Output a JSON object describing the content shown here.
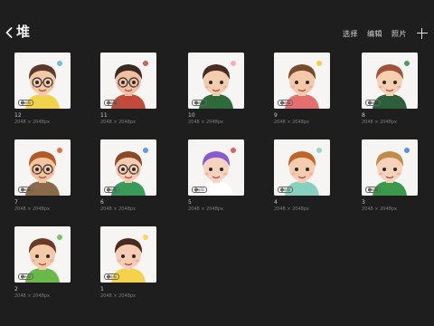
{
  "header": {
    "back_icon": "chevron-left-icon",
    "title": "堆",
    "select_label": "选择",
    "edit_label": "编辑",
    "photos_label": "照片",
    "add_icon": "plus-icon"
  },
  "artworks": [
    {
      "name": "12",
      "size": "2048 × 2048px",
      "watermark": "🅢ellii",
      "hair": "#5a3a2a",
      "skin": "#f3c9a8",
      "shirt": "#f0d34a",
      "glasses": true,
      "accent": "#5fb0d6"
    },
    {
      "name": "11",
      "size": "2048 × 2048px",
      "watermark": "🅢ellii",
      "hair": "#3a2a24",
      "skin": "#f0c0a0",
      "shirt": "#c24a3a",
      "glasses": true,
      "accent": "#c24a3a"
    },
    {
      "name": "10",
      "size": "2048 × 2048px",
      "watermark": "🅢ellii",
      "hair": "#4a2a22",
      "skin": "#f4cdb0",
      "shirt": "#2f6a3a",
      "glasses": false,
      "accent": "#f2a0b4"
    },
    {
      "name": "9",
      "size": "2048 × 2048px",
      "watermark": "🅢ellii",
      "hair": "#7a4a2e",
      "skin": "#f4c9aa",
      "shirt": "#e36f6f",
      "glasses": false,
      "accent": "#f4c430"
    },
    {
      "name": "8",
      "size": "2048 × 2048px",
      "watermark": "🅢ellii",
      "hair": "#a0523a",
      "skin": "#f6cfb0",
      "shirt": "#2f5f3a",
      "glasses": false,
      "accent": "#2f8a4a"
    },
    {
      "name": "7",
      "size": "2048 × 2048px",
      "watermark": "🅢ellii",
      "hair": "#b25a2a",
      "skin": "#f4c59f",
      "shirt": "#8a6a4a",
      "glasses": true,
      "accent": "#e0552f"
    },
    {
      "name": "6",
      "size": "2048 × 2048px",
      "watermark": "🅢ellii",
      "hair": "#8a4a2a",
      "skin": "#f6ccb0",
      "shirt": "#3a9a5a",
      "glasses": true,
      "accent": "#4a8ad6"
    },
    {
      "name": "5",
      "size": "2048 × 2048px",
      "watermark": "🅢ellii",
      "hair": "#8a5ad0",
      "skin": "#f6d3be",
      "shirt": "#ffffff",
      "glasses": false,
      "accent": "#e0404a"
    },
    {
      "name": "4",
      "size": "2048 × 2048px",
      "watermark": "🅢ellii",
      "hair": "#c0652a",
      "skin": "#f6ccb0",
      "shirt": "#8ad0c0",
      "glasses": false,
      "accent": "#8ad0c0"
    },
    {
      "name": "3",
      "size": "2048 × 2048px",
      "watermark": "🅢ellii",
      "hair": "#c08a4a",
      "skin": "#f6d2ba",
      "shirt": "#3a9a4a",
      "glasses": false,
      "accent": "#4a7ad6"
    },
    {
      "name": "2",
      "size": "2048 × 2048px",
      "watermark": "🅢ellii",
      "hair": "#6a3a24",
      "skin": "#f3c9a8",
      "shirt": "#6ab84a",
      "glasses": false,
      "accent": "#6ab84a"
    },
    {
      "name": "1",
      "size": "2048 × 2048px",
      "watermark": "🅢ellii",
      "hair": "#4a2a1e",
      "skin": "#f6cdb2",
      "shirt": "#f4d24a",
      "glasses": false,
      "accent": "#f4d24a"
    }
  ]
}
